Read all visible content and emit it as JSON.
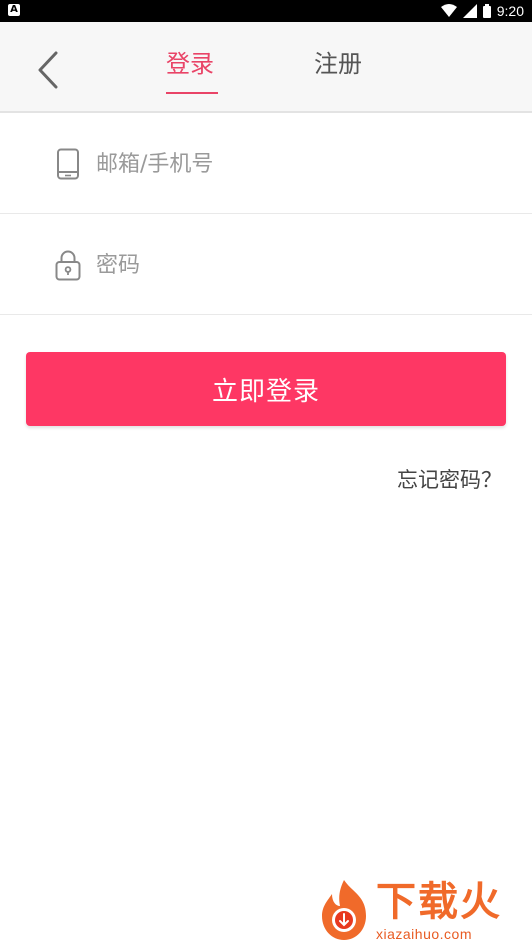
{
  "status_bar": {
    "time": "9:20",
    "left_badge": "A"
  },
  "header": {
    "tabs": [
      {
        "label": "登录",
        "active": true
      },
      {
        "label": "注册",
        "active": false
      }
    ]
  },
  "form": {
    "email_placeholder": "邮箱/手机号",
    "password_placeholder": "密码",
    "email_value": "",
    "password_value": ""
  },
  "actions": {
    "login_label": "立即登录",
    "forgot_label": "忘记密码？"
  },
  "watermark": {
    "brand": "下载火",
    "url": "xiazaihuo.com"
  },
  "colors": {
    "accent": "#fe3764",
    "tab_active": "#e94467",
    "watermark": "#f06a2a"
  },
  "icons": {
    "back": "chevron-left-icon",
    "phone": "phone-icon",
    "lock": "lock-icon"
  }
}
